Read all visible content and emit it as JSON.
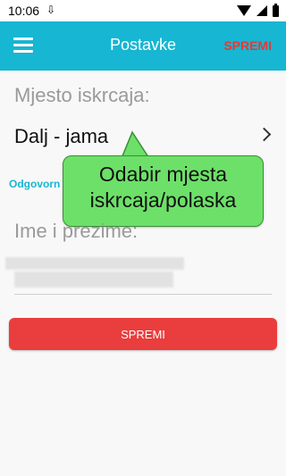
{
  "status_bar": {
    "time": "10:06",
    "notification_icon": "download-arrow-icon",
    "icons": [
      "wifi-icon",
      "cell-signal-icon",
      "battery-icon"
    ]
  },
  "app_bar": {
    "title": "Postavke",
    "save_label": "SPREMI",
    "menu_icon": "hamburger-menu-icon",
    "color": "#17b6d2",
    "save_color": "#e53935"
  },
  "form": {
    "location_label": "Mjesto iskrcaja:",
    "location_value": "Dalj - jama",
    "responsible_link": "Odgovorn",
    "name_label": "Ime i prezime:",
    "name_value": ""
  },
  "tooltip": {
    "text": "Odabir mjesta iskrcaja/polaska",
    "color": "#6de069"
  },
  "primary_button": {
    "label": "SPREMI",
    "color": "#ea3d3d"
  }
}
